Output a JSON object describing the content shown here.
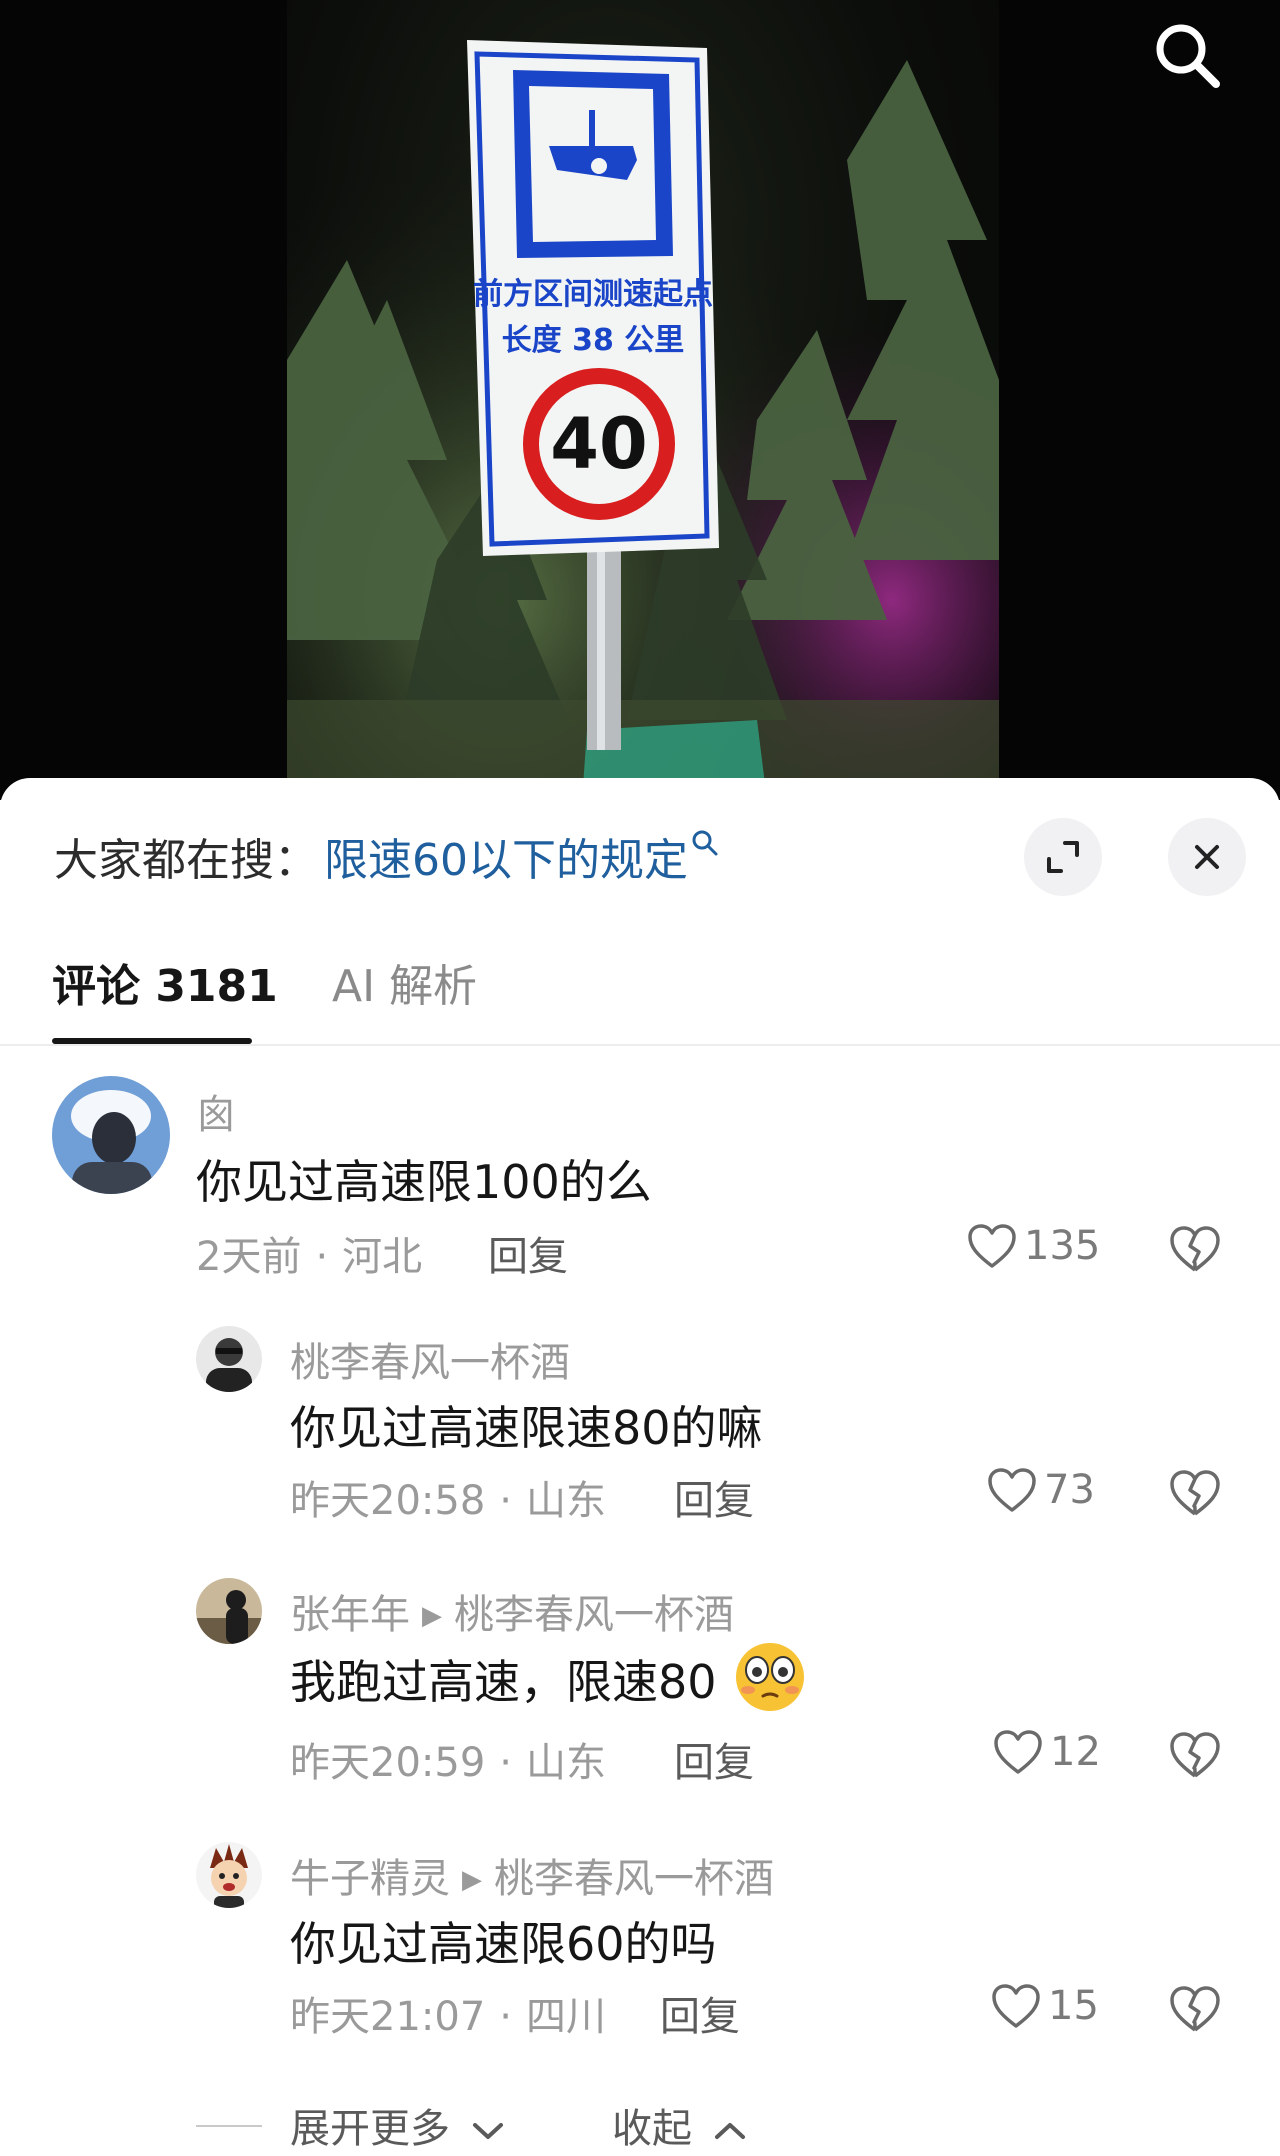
{
  "video": {
    "sign_text_line1": "前方区间测速起点",
    "sign_text_line2": "长度 38 公里",
    "sign_speed": "40",
    "search_icon": "search-icon"
  },
  "sheet": {
    "hot_search_label": "大家都在搜：",
    "hot_search_query": "限速60以下的规定",
    "expand_icon": "expand-icon",
    "close_icon": "close-icon"
  },
  "tabs": {
    "comments": "评论 3181",
    "ai": "AI 解析"
  },
  "comments": [
    {
      "author": "囪",
      "text": "你见过高速限100的么",
      "time": "2天前",
      "location": "河北",
      "reply": "回复",
      "likes": "135"
    },
    {
      "author": "桃李春风一杯酒",
      "text": "你见过高速限速80的嘛",
      "time": "昨天20:58",
      "location": "山东",
      "reply": "回复",
      "likes": "73"
    },
    {
      "author": "张年年",
      "reply_to": "桃李春风一杯酒",
      "text": "我跑过高速，限速80",
      "emoji": "flushed-face-emoji",
      "time": "昨天20:59",
      "location": "山东",
      "reply": "回复",
      "likes": "12"
    },
    {
      "author": "牛子精灵",
      "reply_to": "桃李春风一杯酒",
      "text": "你见过高速限60的吗",
      "time": "昨天21:07",
      "location": "四川",
      "reply": "回复",
      "likes": "15"
    }
  ],
  "footer": {
    "expand_more": "展开更多",
    "collapse": "收起"
  },
  "colors": {
    "link_blue": "#1f5f9e",
    "meta_gray": "#9a9a9a",
    "text_dark": "#161616",
    "sign_blue": "#1a45c8",
    "sign_red": "#d81e1e"
  }
}
